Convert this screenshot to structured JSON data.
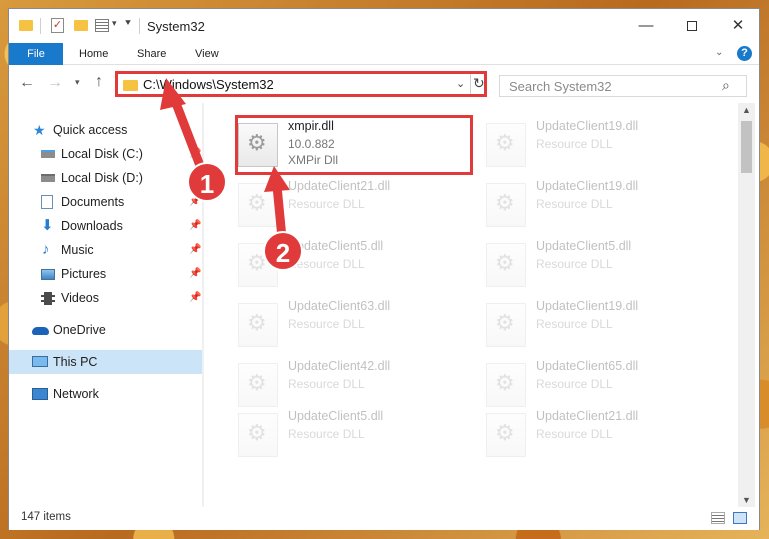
{
  "window": {
    "title": "System32",
    "minimize_glyph": "—",
    "close_glyph": "✕"
  },
  "ribbon": {
    "tabs": [
      "File",
      "Home",
      "Share",
      "View"
    ],
    "help_glyph": "?"
  },
  "navigation": {
    "back_glyph": "←",
    "forward_glyph": "→",
    "recent_glyph": "▾",
    "up_glyph": "↑",
    "address": "C:\\Windows\\System32",
    "search_placeholder": "Search System32",
    "search_glyph": "⌕"
  },
  "nav_pane": {
    "items": [
      {
        "label": "Quick access",
        "icon": "star-icon",
        "pinned": false
      },
      {
        "label": "Local Disk (C:)",
        "icon": "drive-icon",
        "pinned": true
      },
      {
        "label": "Local Disk (D:)",
        "icon": "drive-icon",
        "pinned": true
      },
      {
        "label": "Documents",
        "icon": "documents-icon",
        "pinned": true
      },
      {
        "label": "Downloads",
        "icon": "download-icon",
        "pinned": true
      },
      {
        "label": "Music",
        "icon": "music-icon",
        "pinned": true
      },
      {
        "label": "Pictures",
        "icon": "pictures-icon",
        "pinned": true
      },
      {
        "label": "Videos",
        "icon": "videos-icon",
        "pinned": true
      },
      {
        "label": "OneDrive",
        "icon": "cloud-icon",
        "pinned": false
      },
      {
        "label": "This PC",
        "icon": "computer-icon",
        "pinned": false,
        "selected": true
      },
      {
        "label": "Network",
        "icon": "network-icon",
        "pinned": false
      }
    ],
    "pin_glyph": "📌"
  },
  "files": [
    {
      "name": "xmpir.dll",
      "version": "10.0.882",
      "description": "XMPir Dll",
      "highlighted": true
    },
    {
      "name": "UpdateClient19.dll",
      "description": "Resource DLL"
    },
    {
      "name": "UpdateClient21.dll",
      "description": "Resource DLL"
    },
    {
      "name": "UpdateClient19.dll",
      "description": "Resource DLL"
    },
    {
      "name": "UpdateClient5.dll",
      "description": "Resource DLL"
    },
    {
      "name": "UpdateClient5.dll",
      "description": "Resource DLL"
    },
    {
      "name": "UpdateClient63.dll",
      "description": "Resource DLL"
    },
    {
      "name": "UpdateClient19.dll",
      "description": "Resource DLL"
    },
    {
      "name": "UpdateClient42.dll",
      "description": "Resource DLL"
    },
    {
      "name": "UpdateClient65.dll",
      "description": "Resource DLL"
    },
    {
      "name": "UpdateClient5.dll",
      "description": "Resource DLL"
    },
    {
      "name": "UpdateClient21.dll",
      "description": "Resource DLL"
    }
  ],
  "gear_glyph": "⚙",
  "status": {
    "item_count": "147 items"
  },
  "annotations": {
    "badge_1": "1",
    "badge_2": "2",
    "color": "#e03a3a"
  },
  "colors": {
    "accent": "#1979ca",
    "selection": "#cce4f7",
    "highlight": "#e03a3a"
  }
}
